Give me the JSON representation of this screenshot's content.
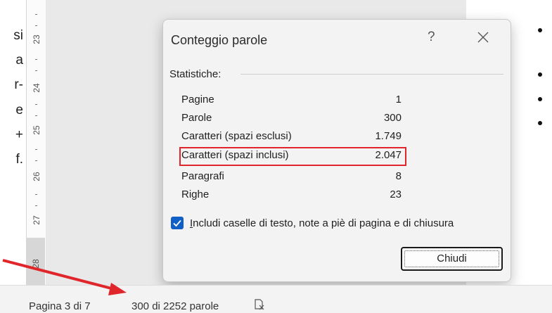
{
  "document": {
    "left_fragments": [
      "si",
      "a",
      "r-",
      "e",
      "+",
      "f."
    ],
    "ruler_numbers": [
      "23",
      "24",
      "25",
      "26",
      "27",
      "28"
    ]
  },
  "dialog": {
    "title": "Conteggio parole",
    "help": "?",
    "section": "Statistiche:",
    "rows": [
      {
        "label": "Pagine",
        "value": "1"
      },
      {
        "label": "Parole",
        "value": "300"
      },
      {
        "label": "Caratteri (spazi esclusi)",
        "value": "1.749"
      },
      {
        "label": "Caratteri (spazi inclusi)",
        "value": "2.047"
      },
      {
        "label": "Paragrafi",
        "value": "8"
      },
      {
        "label": "Righe",
        "value": "23"
      }
    ],
    "checkbox_label_mnemonic": "I",
    "checkbox_label_rest": "ncludi caselle di testo, note a piè di pagina e di chiusura",
    "checkbox_checked": true,
    "close_button": "Chiudi"
  },
  "status_bar": {
    "page": "Pagina 3 di 7",
    "words": "300 di 2252 parole"
  },
  "colors": {
    "accent": "#0f5fc6",
    "highlight": "#e0262a",
    "arrow": "#e0262a"
  }
}
